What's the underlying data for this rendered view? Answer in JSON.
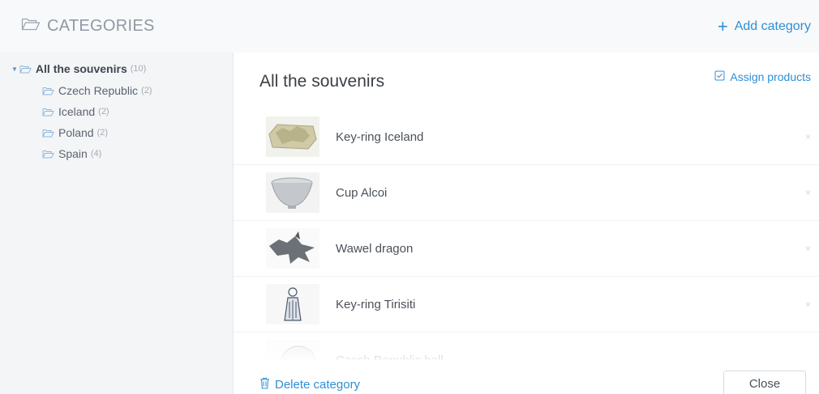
{
  "header": {
    "title": "CATEGORIES",
    "add_label": "Add category"
  },
  "sidebar": {
    "root": {
      "label": "All the souvenirs",
      "count": "(10)"
    },
    "items": [
      {
        "label": "Czech Republic",
        "count": "(2)"
      },
      {
        "label": "Iceland",
        "count": "(2)"
      },
      {
        "label": "Poland",
        "count": "(2)"
      },
      {
        "label": "Spain",
        "count": "(4)"
      }
    ]
  },
  "main": {
    "title": "All the souvenirs",
    "assign_label": "Assign products",
    "products": [
      {
        "name": "Key-ring Iceland",
        "remove": "×"
      },
      {
        "name": "Cup Alcoi",
        "remove": "×"
      },
      {
        "name": "Wawel dragon",
        "remove": "×"
      },
      {
        "name": "Key-ring Tirisiti",
        "remove": "×"
      },
      {
        "name": "Czech Republic ball",
        "remove": "×"
      }
    ]
  },
  "footer": {
    "delete_label": "Delete category",
    "close_label": "Close"
  },
  "colors": {
    "accent": "#2d8fd5",
    "sidebar_bg": "#f4f5f7",
    "header_bg": "#f8f9fa"
  }
}
